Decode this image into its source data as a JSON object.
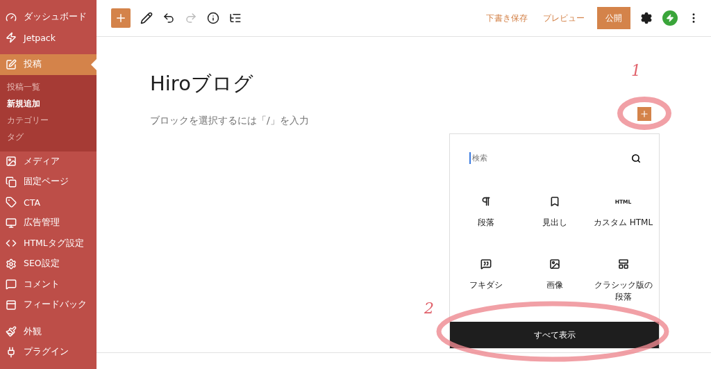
{
  "sidebar": {
    "menu_groups": [
      {
        "items": [
          {
            "label": "ダッシュボード",
            "selected": false
          },
          {
            "label": "Jetpack",
            "selected": false
          },
          {
            "label": "投稿",
            "selected": true,
            "children": [
              {
                "label": "投稿一覧",
                "selected": false
              },
              {
                "label": "新規追加",
                "selected": true
              },
              {
                "label": "カテゴリー",
                "selected": false
              },
              {
                "label": "タグ",
                "selected": false
              }
            ]
          },
          {
            "label": "メディア",
            "selected": false
          },
          {
            "label": "固定ページ",
            "selected": false
          },
          {
            "label": "CTA",
            "selected": false
          },
          {
            "label": "広告管理",
            "selected": false
          },
          {
            "label": "HTMLタグ設定",
            "selected": false
          },
          {
            "label": "SEO設定",
            "selected": false
          },
          {
            "label": "コメント",
            "selected": false
          },
          {
            "label": "フィードバック",
            "selected": false
          }
        ]
      },
      {
        "items": [
          {
            "label": "外観",
            "selected": false
          },
          {
            "label": "プラグイン",
            "selected": false
          }
        ]
      }
    ]
  },
  "toolbar": {
    "undo": {
      "disabled": false
    },
    "redo": {
      "disabled": true
    },
    "save_draft": "下書き保存",
    "preview": "プレビュー",
    "publish": "公開"
  },
  "editor": {
    "title": "Hiroブログ",
    "block_placeholder": "ブロックを選択するには「/」を入力"
  },
  "inserter": {
    "search": {
      "placeholder": "検索"
    },
    "blocks": [
      {
        "label": "段落"
      },
      {
        "label": "見出し"
      },
      {
        "label": "カスタム HTML",
        "icon_text": "HTML"
      },
      {
        "label": "フキダシ"
      },
      {
        "label": "画像"
      },
      {
        "label": "クラシック版の段落"
      }
    ],
    "show_all": "すべて表示"
  },
  "annotations": [
    {
      "label": "1"
    },
    {
      "label": "2"
    }
  ]
}
